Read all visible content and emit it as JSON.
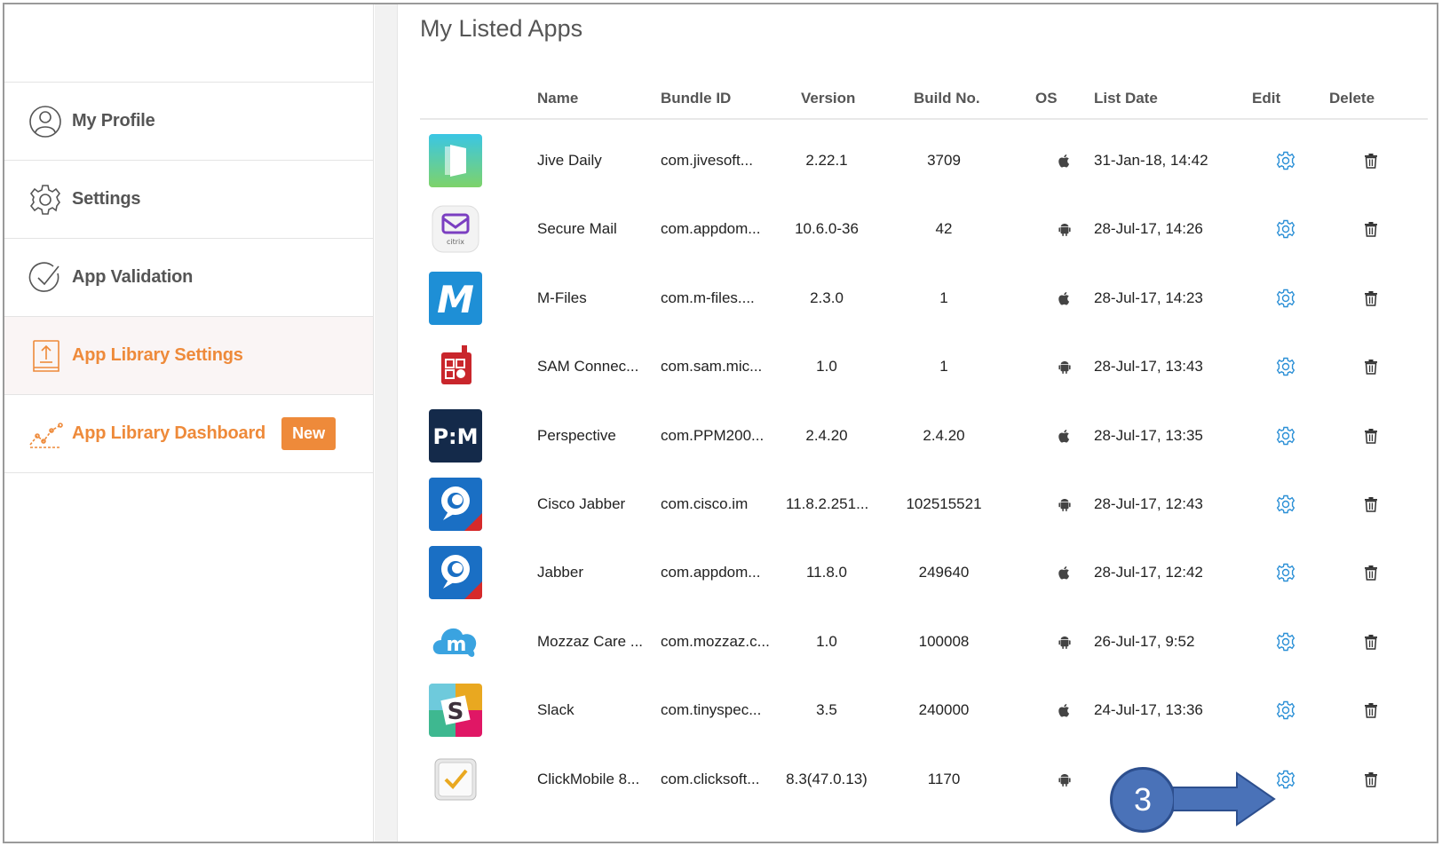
{
  "sidebar": {
    "items": [
      {
        "label": "My Profile",
        "icon": "user-circle-icon"
      },
      {
        "label": "Settings",
        "icon": "gear-icon"
      },
      {
        "label": "App Validation",
        "icon": "check-circle-icon"
      },
      {
        "label": "App Library Settings",
        "icon": "upload-book-icon"
      },
      {
        "label": "App Library Dashboard",
        "icon": "trend-chart-icon",
        "badge": "New"
      }
    ]
  },
  "main": {
    "title": "My Listed Apps",
    "columns": [
      "Name",
      "Bundle ID",
      "Version",
      "Build No.",
      "OS",
      "List Date",
      "Edit",
      "Delete"
    ],
    "rows": [
      {
        "name": "Jive Daily",
        "bundle_id": "com.jivesoft...",
        "version": "2.22.1",
        "build": "3709",
        "os": "apple",
        "list_date": "31-Jan-18, 14:42",
        "icon": "jive-daily-icon"
      },
      {
        "name": "Secure Mail",
        "bundle_id": "com.appdom...",
        "version": "10.6.0-36",
        "build": "42",
        "os": "android",
        "list_date": "28-Jul-17, 14:26",
        "icon": "secure-mail-icon"
      },
      {
        "name": "M-Files",
        "bundle_id": "com.m-files....",
        "version": "2.3.0",
        "build": "1",
        "os": "apple",
        "list_date": "28-Jul-17, 14:23",
        "icon": "m-files-icon"
      },
      {
        "name": "SAM Connec...",
        "bundle_id": "com.sam.mic...",
        "version": "1.0",
        "build": "1",
        "os": "android",
        "list_date": "28-Jul-17, 13:43",
        "icon": "sam-connect-icon"
      },
      {
        "name": "Perspective",
        "bundle_id": "com.PPM200...",
        "version": "2.4.20",
        "build": "2.4.20",
        "os": "apple",
        "list_date": "28-Jul-17, 13:35",
        "icon": "perspective-icon"
      },
      {
        "name": "Cisco Jabber",
        "bundle_id": "com.cisco.im",
        "version": "11.8.2.251...",
        "build": "102515521",
        "os": "android",
        "list_date": "28-Jul-17, 12:43",
        "icon": "cisco-jabber-icon"
      },
      {
        "name": "Jabber",
        "bundle_id": "com.appdom...",
        "version": "11.8.0",
        "build": "249640",
        "os": "apple",
        "list_date": "28-Jul-17, 12:42",
        "icon": "jabber-icon"
      },
      {
        "name": "Mozzaz Care ...",
        "bundle_id": "com.mozzaz.c...",
        "version": "1.0",
        "build": "100008",
        "os": "android",
        "list_date": "26-Jul-17, 9:52",
        "icon": "mozzaz-icon"
      },
      {
        "name": "Slack",
        "bundle_id": "com.tinyspec...",
        "version": "3.5",
        "build": "240000",
        "os": "apple",
        "list_date": "24-Jul-17, 13:36",
        "icon": "slack-icon"
      },
      {
        "name": "ClickMobile 8...",
        "bundle_id": "com.clicksoft...",
        "version": "8.3(47.0.13)",
        "build": "1170",
        "os": "android",
        "list_date": "",
        "icon": "clickmobile-icon"
      }
    ]
  },
  "annotation": {
    "step": "3"
  },
  "colors": {
    "accent_orange": "#ee8a3a",
    "edit_blue": "#2a8fd6",
    "callout_blue": "#4a72b8"
  }
}
